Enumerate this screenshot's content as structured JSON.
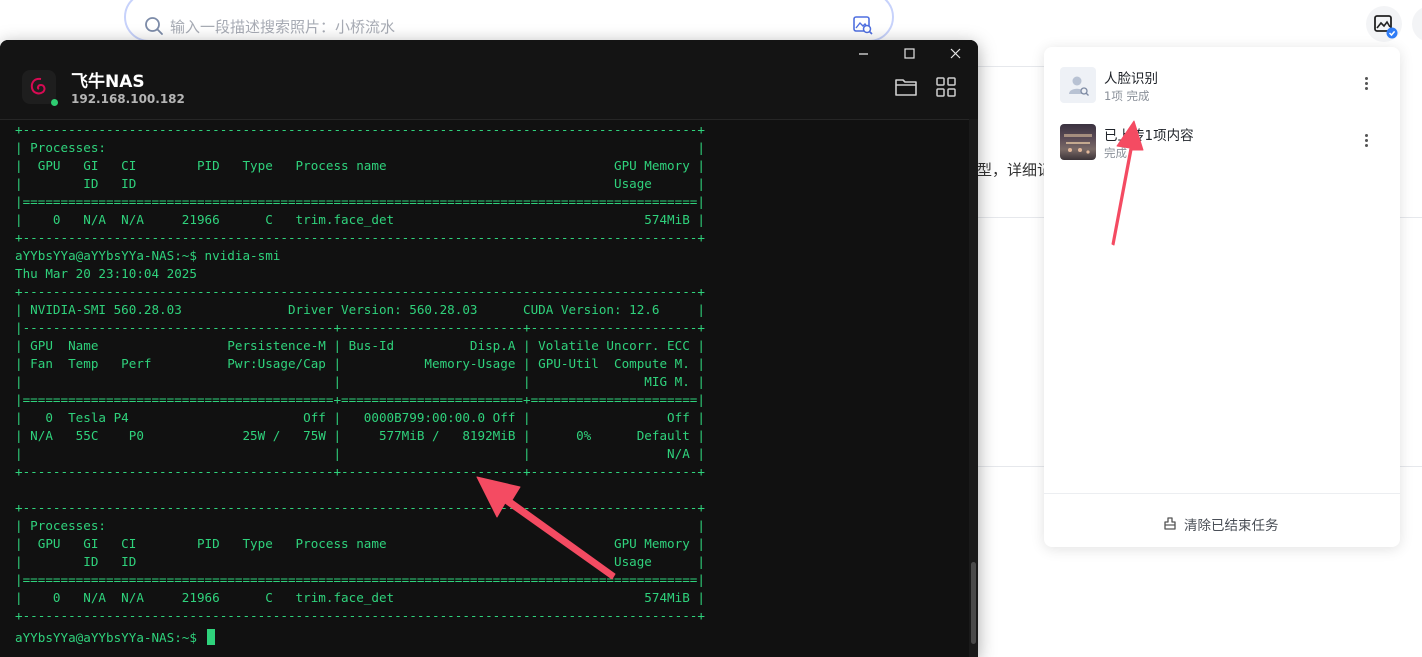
{
  "search": {
    "placeholder": "输入一段描述搜索照片：小桥流水"
  },
  "background": {
    "text_fragment": "型，详细记"
  },
  "terminal": {
    "title": "飞牛NAS",
    "ip": "192.168.100.182",
    "status": "online",
    "output": "+-----------------------------------------------------------------------------------------+\n| Processes:                                                                              |\n|  GPU   GI   CI        PID   Type   Process name                              GPU Memory |\n|        ID   ID                                                               Usage      |\n|=========================================================================================|\n|    0   N/A  N/A     21966      C   trim.face_det                                 574MiB |\n+-----------------------------------------------------------------------------------------+\naYYbsYYa@aYYbsYYa-NAS:~$ nvidia-smi\nThu Mar 20 23:10:04 2025\n+-----------------------------------------------------------------------------------------+\n| NVIDIA-SMI 560.28.03              Driver Version: 560.28.03      CUDA Version: 12.6     |\n|-----------------------------------------+------------------------+----------------------+\n| GPU  Name                 Persistence-M | Bus-Id          Disp.A | Volatile Uncorr. ECC |\n| Fan  Temp   Perf          Pwr:Usage/Cap |           Memory-Usage | GPU-Util  Compute M. |\n|                                         |                        |               MIG M. |\n|=========================================+========================+======================|\n|   0  Tesla P4                       Off |   0000B799:00:00.0 Off |                  Off |\n| N/A   55C    P0             25W /   75W |     577MiB /   8192MiB |      0%      Default |\n|                                         |                        |                  N/A |\n+-----------------------------------------+------------------------+----------------------+\n\n+-----------------------------------------------------------------------------------------+\n| Processes:                                                                              |\n|  GPU   GI   CI        PID   Type   Process name                              GPU Memory |\n|        ID   ID                                                               Usage      |\n|=========================================================================================|\n|    0   N/A  N/A     21966      C   trim.face_det                                 574MiB |\n+-----------------------------------------------------------------------------------------+",
    "prompt": "aYYbsYYa@aYYbsYYa-NAS:~$ "
  },
  "tasks": {
    "items": [
      {
        "title": "人脸识别",
        "subtitle": "1项 完成"
      },
      {
        "title": "已上传1项内容",
        "subtitle": "完成"
      }
    ],
    "clear_label": "清除已结束任务"
  },
  "colors": {
    "terminal_text": "#2fd27c",
    "accent": "#3b82f6",
    "annotation_arrow": "#f44b62"
  }
}
